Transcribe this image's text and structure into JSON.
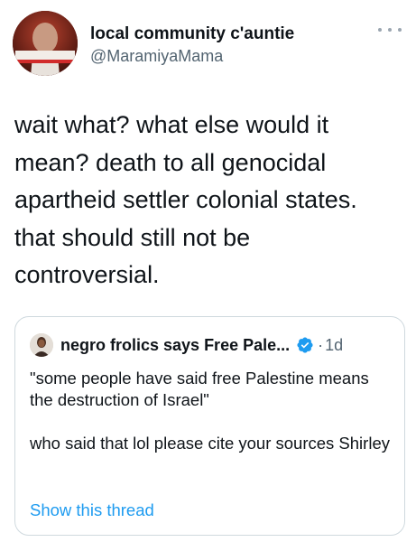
{
  "author": {
    "name": "local community c'auntie",
    "handle": "@MaramiyaMama",
    "avatar_banner_text": "فلسطين أمريكا"
  },
  "tweet": {
    "lines": [
      "wait what? what else would it",
      "mean? death to all genocidal",
      "apartheid settler colonial states.",
      "that should still not be",
      "controversial."
    ]
  },
  "quoted_tweet": {
    "author_name": "negro frolics says Free Pale...",
    "separator": "·",
    "time": "1d",
    "paragraphs": [
      "\"some people have said free Palestine means the destruction of Israel\"",
      "who said that lol please cite your sources Shirley"
    ],
    "show_thread": "Show this thread"
  },
  "icons": {
    "more": "more-horizontal-icon",
    "verified": "verified-badge-icon"
  },
  "colors": {
    "text": "#0f1419",
    "secondary": "#536471",
    "link": "#1d9bf0",
    "border": "#cfd9de"
  }
}
